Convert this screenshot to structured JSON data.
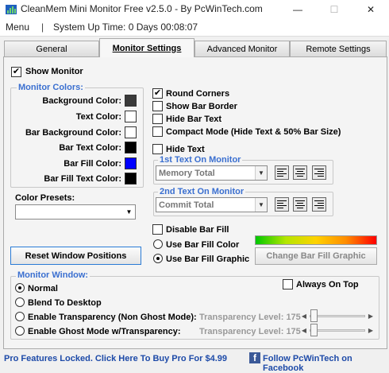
{
  "window": {
    "title": "CleanMem Mini Monitor Free v2.5.0 - By PcWinTech.com",
    "minimize": "—",
    "maximize": "☐",
    "close": "✕"
  },
  "menubar": {
    "menu_label": "Menu",
    "separator": "|",
    "uptime": "System Up Time: 0 Days 00:08:07"
  },
  "tabs": [
    "General",
    "Monitor Settings",
    "Advanced Monitor",
    "Remote Settings"
  ],
  "show_monitor": {
    "label": "Show Monitor",
    "checked": true
  },
  "monitor_colors": {
    "title": "Monitor Colors:",
    "items": [
      {
        "label": "Background Color:",
        "color": "#3a3a3a"
      },
      {
        "label": "Text Color:",
        "color": "#ffffff"
      },
      {
        "label": "Bar Background Color:",
        "color": "#ffffff"
      },
      {
        "label": "Bar Text Color:",
        "color": "#000000"
      },
      {
        "label": "Bar Fill Color:",
        "color": "#0000ff"
      },
      {
        "label": "Bar Fill Text Color:",
        "color": "#000000"
      }
    ]
  },
  "color_presets": {
    "label": "Color Presets:",
    "value": ""
  },
  "options": [
    {
      "label": "Round Corners",
      "checked": true
    },
    {
      "label": "Show Bar Border",
      "checked": false
    },
    {
      "label": "Hide Bar Text",
      "checked": false
    },
    {
      "label": "Compact Mode (Hide Text & 50% Bar Size)",
      "checked": false
    },
    {
      "label": "Hide Text",
      "checked": false
    }
  ],
  "first_text": {
    "title": "1st Text On Monitor",
    "value": "Memory Total"
  },
  "second_text": {
    "title": "2nd Text On Monitor",
    "value": "Commit Total"
  },
  "bar_fill": {
    "disable_label": "Disable Bar Fill",
    "color_label": "Use Bar Fill Color",
    "graphic_label": "Use Bar Fill Graphic",
    "selected": "graphic",
    "change_button": "Change Bar Fill Graphic"
  },
  "reset_button": "Reset Window Positions",
  "monitor_window": {
    "title": "Monitor Window:",
    "always_on_top": "Always On Top",
    "options": [
      {
        "label": "Normal",
        "selected": true
      },
      {
        "label": "Blend To Desktop",
        "selected": false
      },
      {
        "label": "Enable Transparency (Non Ghost Mode):",
        "selected": false
      },
      {
        "label": "Enable Ghost Mode w/Transparency:",
        "selected": false
      }
    ],
    "transparency_label_1": "Transparency Level: 175",
    "transparency_label_2": "Transparency Level: 175"
  },
  "footer": {
    "pro_link": "Pro Features Locked. Click Here To Buy Pro For $4.99",
    "facebook_link": "Follow PcWinTech on Facebook",
    "facebook_icon": "f"
  }
}
